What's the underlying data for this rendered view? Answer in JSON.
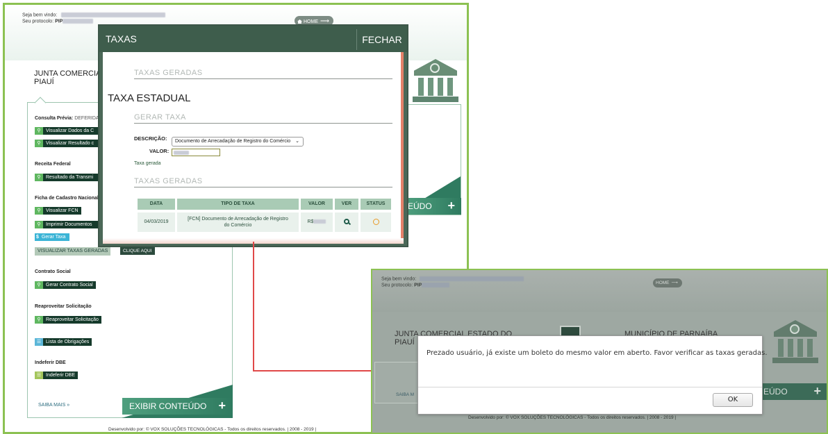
{
  "main": {
    "welcome_label": "Seja bem vindo:",
    "protocol_label": "Seu protocolo:",
    "protocol_prefix": "PIP",
    "home_label": "HOME",
    "org_line1": "JUNTA COMERCIA",
    "org_line2": "PIAUÍ",
    "sections": {
      "consulta_previa": {
        "title": "Consulta Prévia:",
        "status": "DEFERIDA"
      },
      "receita_federal": {
        "title": "Receita Federal"
      },
      "ficha_cadastro": {
        "title": "Ficha de Cadastro Nacional ("
      },
      "contrato_social": {
        "title": "Contrato Social"
      },
      "reaproveitar": {
        "title": "Reaproveitar Solicitação"
      },
      "indeferir": {
        "title": "Indeferir DBE"
      }
    },
    "buttons": {
      "visualizar_dados": "Visualizar Dados da C",
      "visualizar_resultado": "Visualizar Resultado c",
      "resultado_transmissao": "Resultado da Transmi",
      "visualizar_fcn": "Visualizar FCN",
      "imprimir_documentos": "Imprimir Documentos",
      "gerar_taxa": "Gerar Taxa",
      "visualizar_taxas_geradas": "VISUALIZAR TAXAS GERADAS",
      "clique_aqui": "CLIQUE AQUI",
      "gerar_contrato": "Gerar Contrato Social",
      "reaproveitar_solicitacao": "Reaproveitar Solicitação",
      "lista_obrigacoes": "Lista de Obrigações",
      "indeferir_dbe": "Indeferir DBE"
    },
    "saiba_mais": "SAIBA MAIS »",
    "exibir_conteudo": "EXIBIR CONTEÚDO",
    "behind_exibir_fragment": "EÚDO",
    "footer": "Desenvolvido por: © VOX SOLUÇÕES TECNOLÓGICAS - Todos os direitos reservados. | 2008 - 2019 |"
  },
  "taxas_modal": {
    "title": "TAXAS",
    "close_label": "FECHAR",
    "top_section": "TAXAS GERADAS",
    "heading": "TAXA ESTADUAL",
    "gerar_section": "GERAR TAXA",
    "descricao_label": "DESCRIÇÃO:",
    "descricao_value": "Documento de Arrecadação de Registro do Comércio",
    "valor_label": "VALOR:",
    "taxa_gerada_label": "Taxa gerada",
    "geradas_section": "TAXAS GERADAS",
    "table": {
      "headers": [
        "DATA",
        "TIPO DE TAXA",
        "VALOR",
        "VER",
        "STATUS"
      ],
      "rows": [
        {
          "data": "04/03/2019",
          "tipo_line1": "[FCN] Documento de Arrecadação de Registro",
          "tipo_line2": "do Comércio",
          "valor": "R$"
        }
      ]
    }
  },
  "inset": {
    "welcome_label": "Seja bem vindo:",
    "protocol_label": "Seu protocolo:",
    "protocol_prefix": "PIP",
    "home_label": "HOME",
    "org_line1": "JUNTA COMERCIAL ESTADO DO",
    "org_line2": "PIAUÍ",
    "municipio": "MUNICÍPIO DE PARNAÍBA",
    "saiba_fragment": "SAIBA M",
    "exibir_fragment": "EÚDO",
    "footer": "Desenvolvido por: © VOX SOLUÇÕES TECNOLÓGICAS - Todos os direitos reservados. | 2008 - 2019 |"
  },
  "alert": {
    "message": "Prezado usuário, já existe um boleto do mesmo valor em aberto. Favor verificar as taxas geradas.",
    "ok_label": "OK"
  },
  "colors": {
    "frame_border": "#8cc152",
    "modal_header": "#3e5d4c",
    "dark_button": "#153a2b",
    "green_icon": "#5fb760",
    "connector": "#e04848"
  }
}
